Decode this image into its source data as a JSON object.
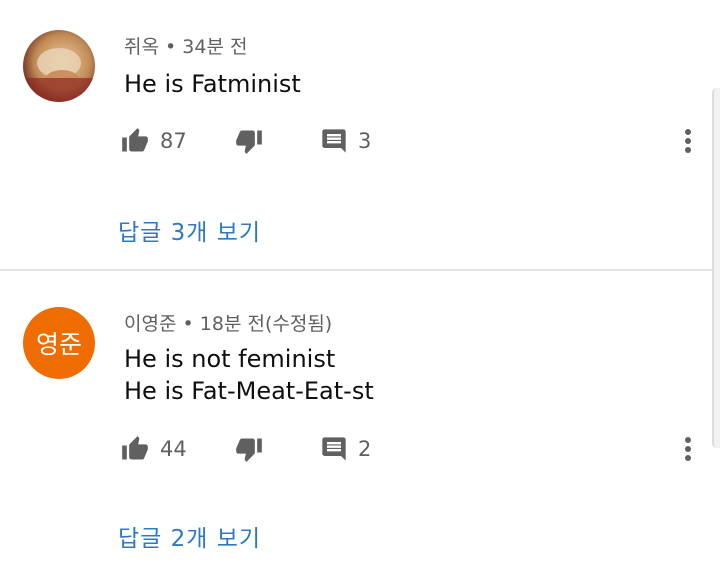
{
  "comments": [
    {
      "author": "쥐옥",
      "separator": "•",
      "time": "34분 전",
      "text_lines": [
        "He is Fatminist"
      ],
      "likes": "87",
      "reply_count": "3",
      "view_replies": "답글 3개 보기",
      "avatar_type": "photo"
    },
    {
      "author": "이영준",
      "separator": "•",
      "time": "18분 전(수정됨)",
      "text_lines": [
        "He is not feminist",
        "He is Fat-Meat-Eat-st"
      ],
      "likes": "44",
      "reply_count": "2",
      "view_replies": "답글 2개 보기",
      "avatar_type": "initials",
      "avatar_initials": "영준",
      "avatar_color": "#ef6c00"
    }
  ],
  "colors": {
    "link": "#2d79c7",
    "meta": "#606060",
    "icon": "#606060"
  },
  "icons": [
    "thumb-up-icon",
    "thumb-down-icon",
    "comment-icon",
    "more-vert-icon"
  ]
}
